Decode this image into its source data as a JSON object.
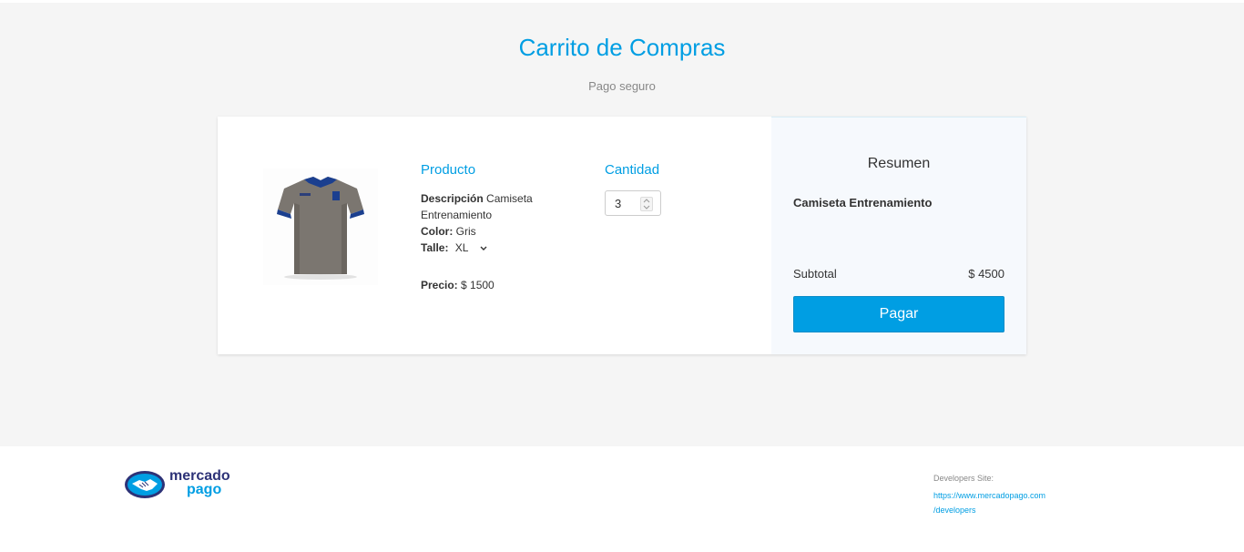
{
  "header": {
    "title": "Carrito de Compras",
    "subtitle": "Pago seguro"
  },
  "product": {
    "image_alt": "Camiseta Entrenamiento gris",
    "column_title": "Producto",
    "description_label": "Descripción",
    "description_value": "Camiseta Entrenamiento",
    "color_label": "Color:",
    "color_value": "Gris",
    "size_label": "Talle:",
    "size_value": "XL",
    "price_label": "Precio:",
    "price_value": "$ 1500"
  },
  "quantity": {
    "column_title": "Cantidad",
    "value": "3"
  },
  "summary": {
    "title": "Resumen",
    "product_name": "Camiseta Entrenamiento",
    "subtotal_label": "Subtotal",
    "subtotal_value": "$ 4500",
    "pay_label": "Pagar"
  },
  "footer": {
    "logo_line1": "mercado",
    "logo_line2": "pago",
    "dev_label": "Developers Site:",
    "dev_link_line1": "https://www.mercadopago.com",
    "dev_link_line2": "/developers"
  },
  "colors": {
    "accent": "#009ee3",
    "page_background": "#f5f5f5",
    "summary_background": "#f6f9fd",
    "logo_navy": "#2d3277"
  },
  "icons": {
    "talle_dropdown": "chevron-down-icon",
    "quantity_spinner": "spinner-arrows-icon",
    "logo": "handshake-icon"
  }
}
